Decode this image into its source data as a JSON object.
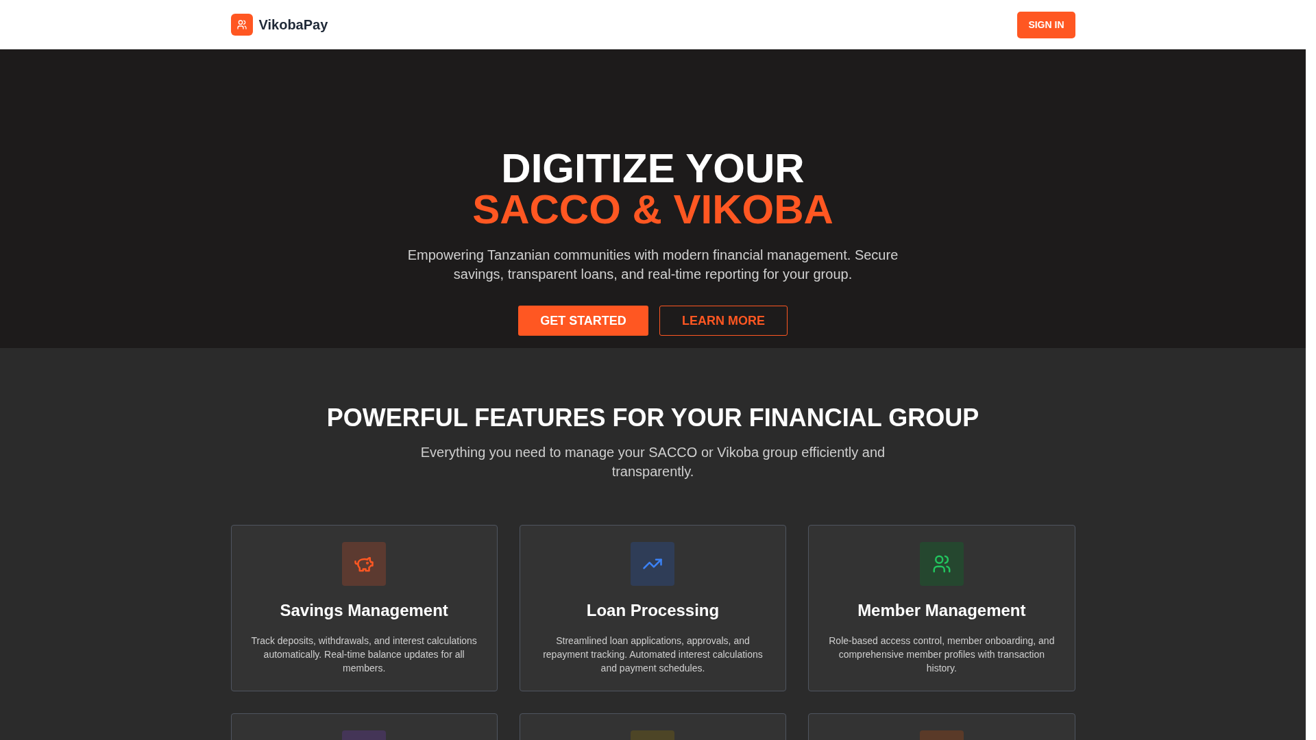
{
  "header": {
    "brand": "VikobaPay",
    "sign_in": "SIGN IN"
  },
  "hero": {
    "title_line_1": "DIGITIZE YOUR",
    "title_line_2": "SACCO & VIKOBA",
    "subtitle": "Empowering Tanzanian communities with modern financial management. Secure savings, transparent loans, and real-time reporting for your group.",
    "buttons": [
      {
        "label": "GET STARTED",
        "kind": "primary"
      },
      {
        "label": "LEARN MORE",
        "kind": "outline"
      }
    ]
  },
  "features": {
    "title": "POWERFUL FEATURES FOR YOUR FINANCIAL GROUP",
    "subtitle": "Everything you need to manage your SACCO or Vikoba group efficiently and transparently.",
    "cards": [
      {
        "kind": "piggy",
        "color": "#5c3a30",
        "title": "Savings Management",
        "description": "Track deposits, withdrawals, and interest calculations automatically. Real-time balance updates for all members."
      },
      {
        "kind": "trend",
        "color": "#2f3d57",
        "title": "Loan Processing",
        "description": "Streamlined loan applications, approvals, and repayment tracking. Automated interest calculations and payment schedules."
      },
      {
        "kind": "users",
        "color": "#25472f",
        "title": "Member Management",
        "description": "Role-based access control, member onboarding, and comprehensive member profiles with transaction history."
      },
      {
        "kind": "hidden",
        "color": "#443557"
      },
      {
        "kind": "hidden",
        "color": "#4d4526"
      },
      {
        "kind": "hidden",
        "color": "#5a3a28"
      }
    ]
  }
}
